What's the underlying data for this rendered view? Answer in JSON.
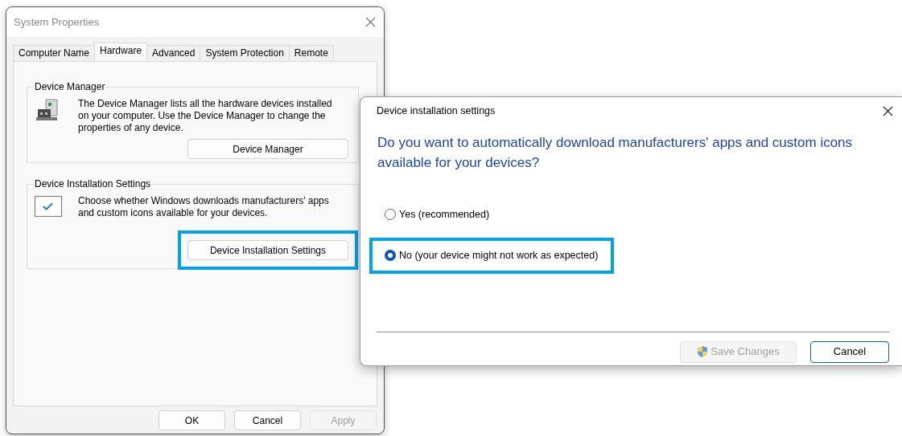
{
  "system_properties": {
    "title": "System Properties",
    "tabs": [
      {
        "label": "Computer Name",
        "selected": false
      },
      {
        "label": "Hardware",
        "selected": true
      },
      {
        "label": "Advanced",
        "selected": false
      },
      {
        "label": "System Protection",
        "selected": false
      },
      {
        "label": "Remote",
        "selected": false
      }
    ],
    "groups": [
      {
        "kind": "device-manager",
        "title": "Device Manager",
        "description": "The Device Manager lists all the hardware devices installed on your computer. Use the Device Manager to change the properties of any device.",
        "button": {
          "label": "Device Manager",
          "highlighted": false
        }
      },
      {
        "kind": "installation",
        "title": "Device Installation Settings",
        "description": "Choose whether Windows downloads manufacturers' apps and custom icons available for your devices.",
        "button": {
          "label": "Device Installation Settings",
          "highlighted": true
        }
      }
    ],
    "buttons": [
      {
        "label": "OK",
        "disabled": false
      },
      {
        "label": "Cancel",
        "disabled": false
      },
      {
        "label": "Apply",
        "disabled": true
      }
    ]
  },
  "dialog": {
    "title": "Device installation settings",
    "question": "Do you want to automatically download manufacturers' apps and custom icons available for your devices?",
    "options": [
      {
        "label": "Yes (recommended)",
        "selected": false,
        "highlighted": false
      },
      {
        "label": "No (your device might not work as expected)",
        "selected": true,
        "highlighted": true
      }
    ],
    "buttons": [
      {
        "label": "Save Changes",
        "disabled": true,
        "kind": "shield"
      },
      {
        "label": "Cancel",
        "disabled": false,
        "kind": "default"
      }
    ]
  }
}
